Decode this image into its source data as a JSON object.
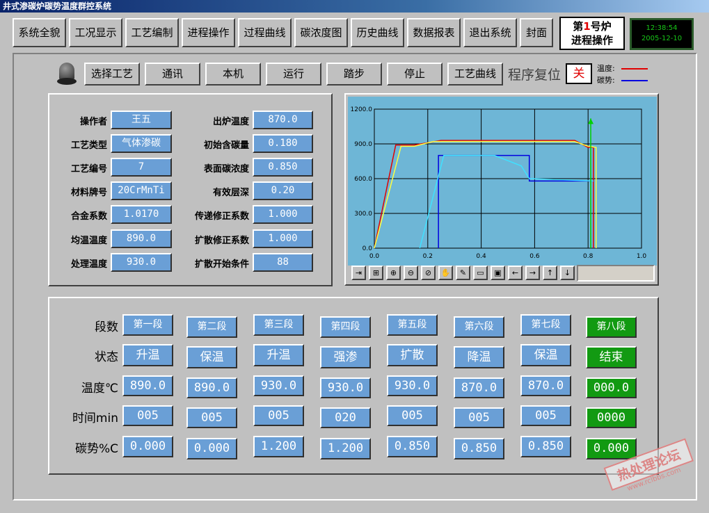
{
  "title": "井式渗碳炉碳势温度群控系统",
  "nav": [
    "系统全貌",
    "工况显示",
    "工艺编制",
    "进程操作",
    "过程曲线",
    "碳浓度图",
    "历史曲线",
    "数据报表",
    "退出系统",
    "封面"
  ],
  "furnace": {
    "prefix": "第",
    "number": "1",
    "suffix": "号炉",
    "mode": "进程操作"
  },
  "clock": {
    "time": "12:38:54",
    "date": "2005-12-10"
  },
  "controls": [
    "选择工艺",
    "通讯",
    "本机",
    "运行",
    "踏步",
    "停止",
    "工艺曲线"
  ],
  "reset_label": "程序复位",
  "reset_state": "关",
  "legend": {
    "temp_label": "温度:",
    "carbon_label": "碳势:",
    "temp_color": "#e00000",
    "carbon_color": "#0000e0"
  },
  "params_left": [
    {
      "label": "操作者",
      "value": "王五"
    },
    {
      "label": "工艺类型",
      "value": "气体渗碳"
    },
    {
      "label": "工艺编号",
      "value": "7"
    },
    {
      "label": "材料牌号",
      "value": "20CrMnTi"
    },
    {
      "label": "合金系数",
      "value": "1.0170"
    },
    {
      "label": "均温温度",
      "value": "890.0"
    },
    {
      "label": "处理温度",
      "value": "930.0"
    }
  ],
  "params_right": [
    {
      "label": "出炉温度",
      "value": "870.0"
    },
    {
      "label": "初始含碳量",
      "value": "0.180"
    },
    {
      "label": "表面碳浓度",
      "value": "0.850"
    },
    {
      "label": "有效层深",
      "value": "0.20"
    },
    {
      "label": "传递修正系数",
      "value": "1.000"
    },
    {
      "label": "扩散修正系数",
      "value": "1.000"
    },
    {
      "label": "扩散开始条件",
      "value": "88"
    }
  ],
  "chart_data": {
    "type": "line",
    "xlim": [
      0,
      1.0
    ],
    "ylim": [
      0,
      1200
    ],
    "x_ticks": [
      "0.0",
      "0.2",
      "0.4",
      "0.6",
      "0.8",
      "1.0"
    ],
    "y_ticks": [
      "0.0",
      "300.0",
      "600.0",
      "900.0",
      "1200.0"
    ],
    "grid": true,
    "series": [
      {
        "color": "#e00000",
        "x": [
          0,
          0.08,
          0.15,
          0.25,
          0.6,
          0.75,
          0.8,
          0.82,
          0.82
        ],
        "y": [
          0,
          890,
          890,
          930,
          930,
          930,
          870,
          870,
          0
        ]
      },
      {
        "color": "#ffff40",
        "x": [
          0,
          0.1,
          0.15,
          0.22,
          0.7,
          0.75,
          0.8,
          0.83,
          0.83
        ],
        "y": [
          0,
          880,
          880,
          920,
          920,
          920,
          880,
          870,
          0
        ]
      },
      {
        "color": "#0000e0",
        "x": [
          0.24,
          0.24,
          0.58,
          0.58,
          0.82
        ],
        "y": [
          0,
          800,
          800,
          580,
          580
        ]
      },
      {
        "color": "#40e0ff",
        "x": [
          0.17,
          0.26,
          0.45,
          0.55,
          0.58,
          0.82
        ],
        "y": [
          0,
          800,
          800,
          710,
          600,
          580
        ]
      },
      {
        "color": "#00d000",
        "x": [
          0.81,
          0.81
        ],
        "y": [
          0,
          1120
        ]
      }
    ]
  },
  "toolbar_icons": [
    "exit-icon",
    "add-icon",
    "zoom-in-icon",
    "zoom-out-icon",
    "zoom-reset-icon",
    "pan-icon",
    "edit-icon",
    "open-icon",
    "save-icon",
    "left-arrow-icon",
    "right-arrow-icon",
    "up-arrow-icon",
    "down-arrow-icon"
  ],
  "row_labels": [
    "段数",
    "状态",
    "温度℃",
    "时间min",
    "碳势%C"
  ],
  "segments": [
    {
      "name": "第一段",
      "state": "升温",
      "temp": "890.0",
      "time": "005",
      "carbon": "0.000"
    },
    {
      "name": "第二段",
      "state": "保温",
      "temp": "890.0",
      "time": "005",
      "carbon": "0.000"
    },
    {
      "name": "第三段",
      "state": "升温",
      "temp": "930.0",
      "time": "005",
      "carbon": "1.200"
    },
    {
      "name": "第四段",
      "state": "强渗",
      "temp": "930.0",
      "time": "020",
      "carbon": "1.200"
    },
    {
      "name": "第五段",
      "state": "扩散",
      "temp": "930.0",
      "time": "005",
      "carbon": "0.850"
    },
    {
      "name": "第六段",
      "state": "降温",
      "temp": "870.0",
      "time": "005",
      "carbon": "0.850"
    },
    {
      "name": "第七段",
      "state": "保温",
      "temp": "870.0",
      "time": "005",
      "carbon": "0.850"
    },
    {
      "name": "第八段",
      "state": "结束",
      "temp": "000.0",
      "time": "0000",
      "carbon": "0.000"
    }
  ],
  "watermark": {
    "text": "热处理论坛",
    "url": "www.rclbbs.com"
  }
}
